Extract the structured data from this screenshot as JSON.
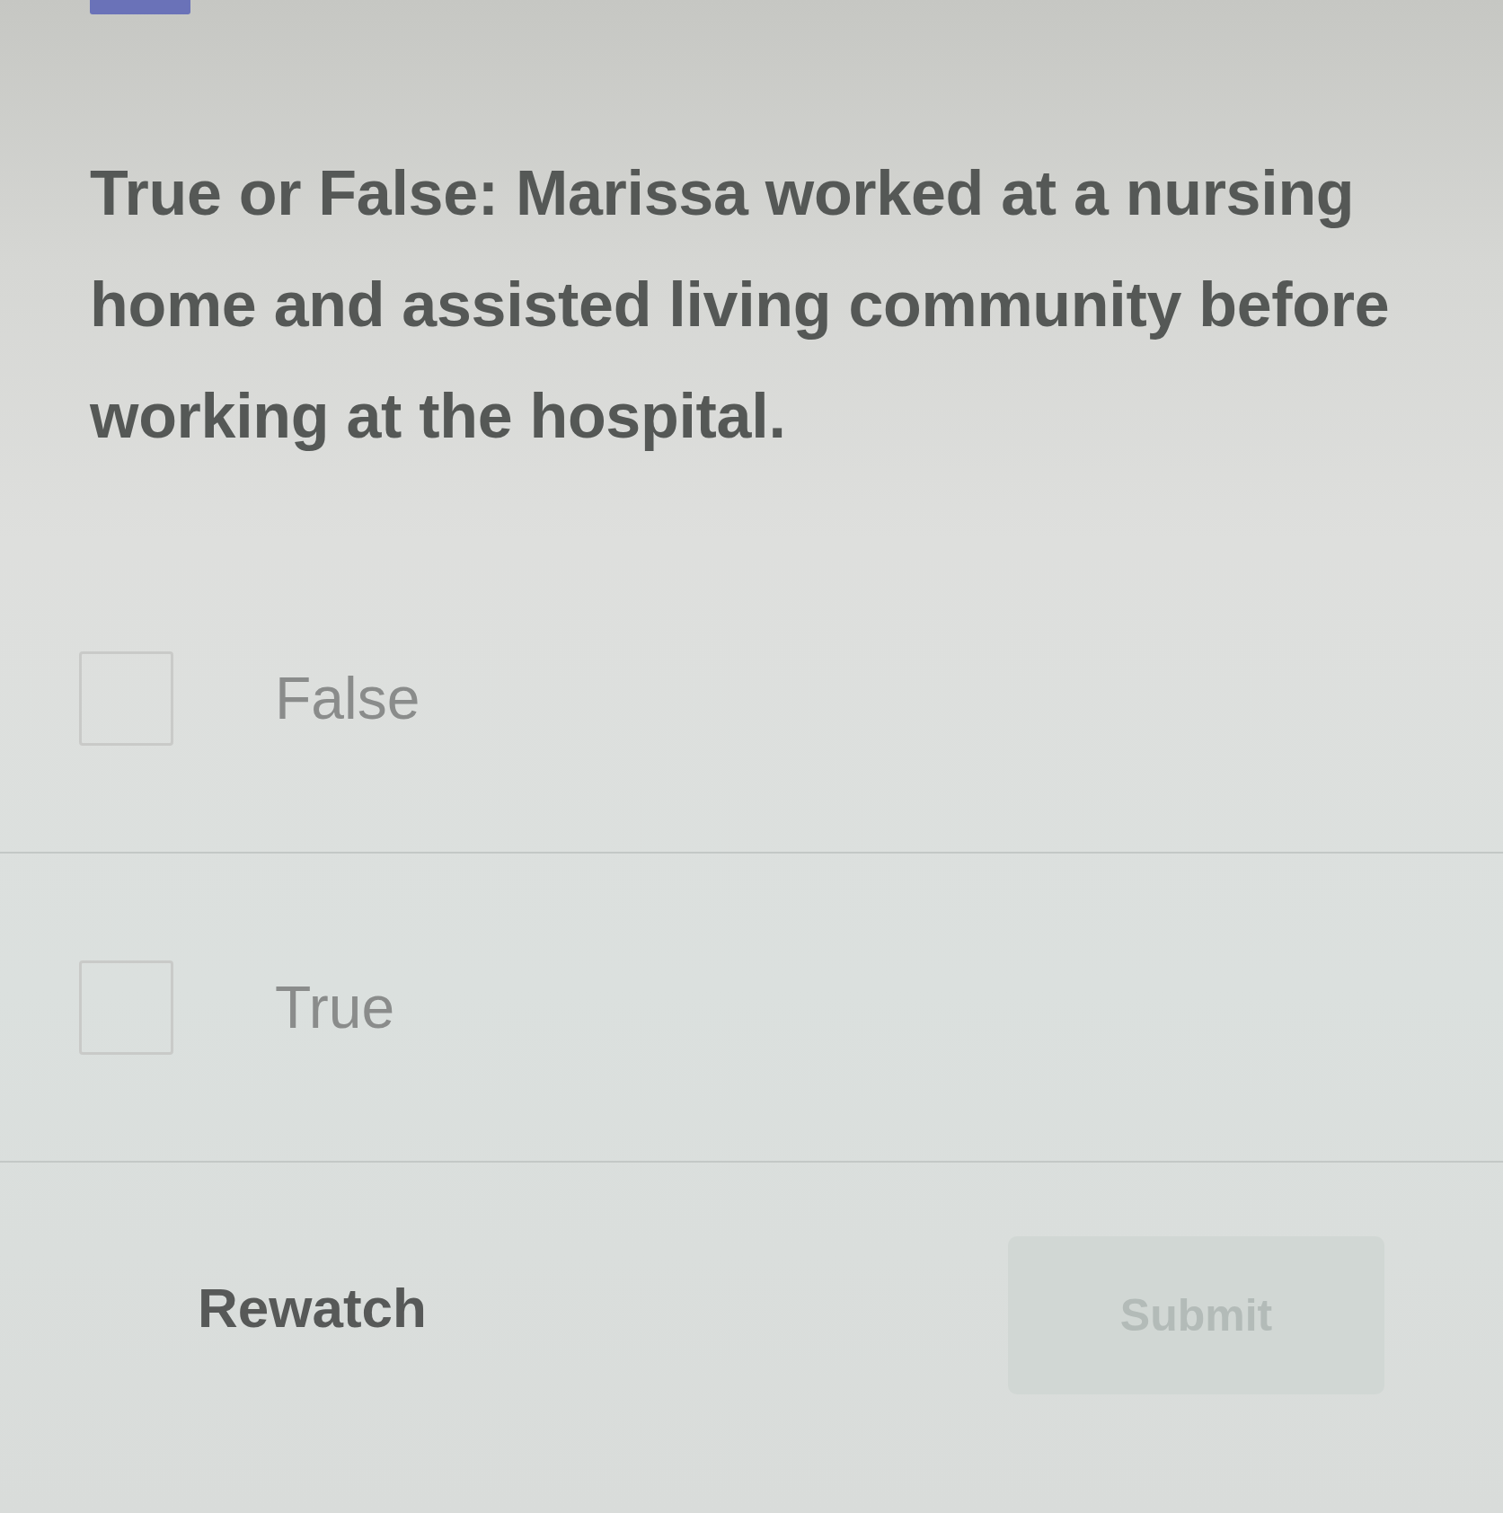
{
  "question": {
    "text": "True or False: Marissa worked at a nursing home and assisted living community before working at the hospital."
  },
  "options": [
    {
      "label": "False",
      "checked": false
    },
    {
      "label": "True",
      "checked": false
    }
  ],
  "footer": {
    "rewatch_button": "Rewatch",
    "submit_button": {
      "label": "Submit",
      "disabled": true
    }
  }
}
